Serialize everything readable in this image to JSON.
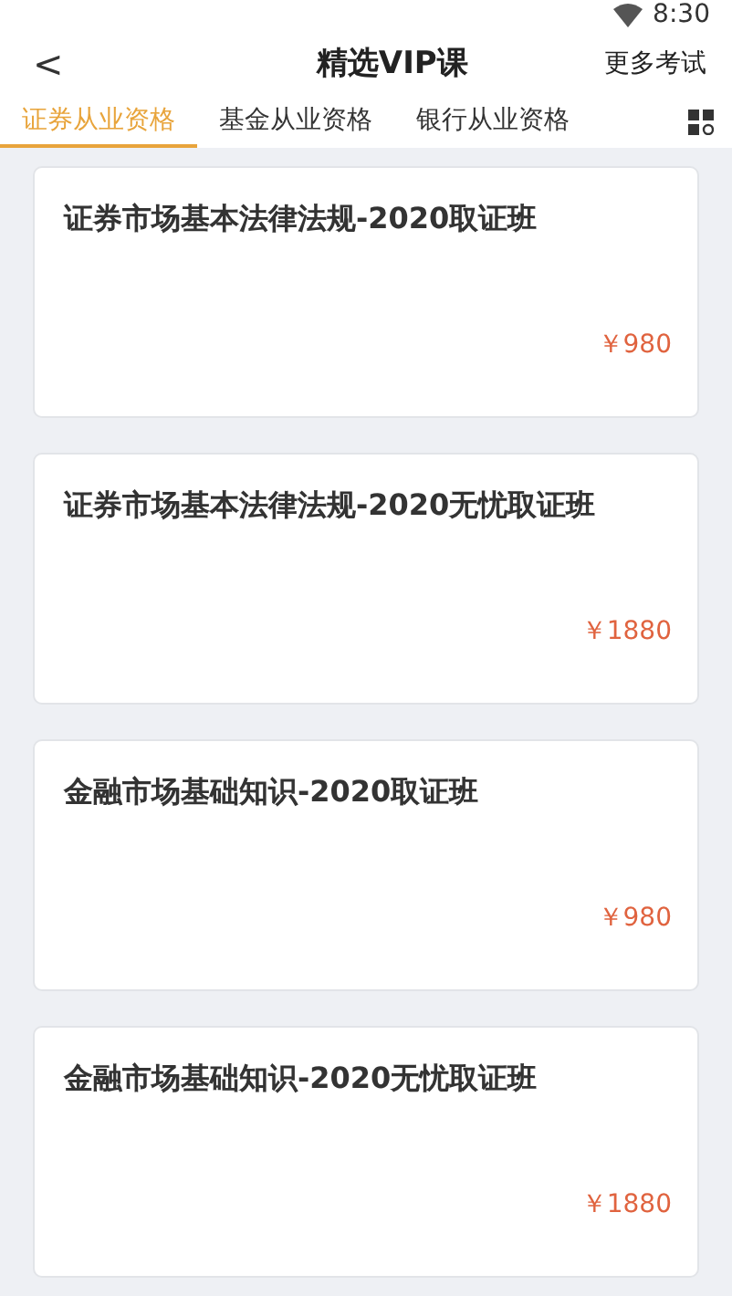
{
  "status_bar": {
    "time": "8:30"
  },
  "header": {
    "back": "<",
    "title": "精选VIP课",
    "action": "更多考试"
  },
  "tabs": [
    {
      "label": "证券从业资格",
      "selected": true
    },
    {
      "label": "基金从业资格",
      "selected": false
    },
    {
      "label": "银行从业资格",
      "selected": false
    }
  ],
  "courses": [
    {
      "title": "证券市场基本法律法规-2020取证班",
      "price": "￥980"
    },
    {
      "title": "证券市场基本法律法规-2020无忧取证班",
      "price": "￥1880"
    },
    {
      "title": "金融市场基础知识-2020取证班",
      "price": "￥980"
    },
    {
      "title": "金融市场基础知识-2020无忧取证班",
      "price": "￥1880"
    }
  ]
}
